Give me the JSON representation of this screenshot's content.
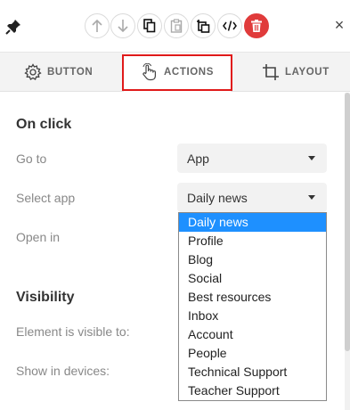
{
  "toolbar": {
    "buttons": [
      {
        "name": "move-up",
        "icon": "arrow-up-icon"
      },
      {
        "name": "move-down",
        "icon": "arrow-down-icon"
      },
      {
        "name": "copy",
        "icon": "copy-icon"
      },
      {
        "name": "paste",
        "icon": "clipboard-icon"
      },
      {
        "name": "duplicate",
        "icon": "duplicate-icon"
      },
      {
        "name": "code",
        "icon": "code-icon"
      },
      {
        "name": "delete",
        "icon": "trash-icon"
      }
    ],
    "pin_icon": "pin-icon",
    "close_label": "×",
    "delete_color": "#e03b3b"
  },
  "tabs": [
    {
      "label": "BUTTON",
      "icon": "gear-icon",
      "active": false
    },
    {
      "label": "ACTIONS",
      "icon": "hand-pointer-icon",
      "active": true
    },
    {
      "label": "LAYOUT",
      "icon": "crop-icon",
      "active": false
    }
  ],
  "on_click": {
    "title": "On click",
    "go_to_label": "Go to",
    "go_to_value": "App",
    "select_app_label": "Select app",
    "select_app_value": "Daily news",
    "open_in_label": "Open in"
  },
  "visibility": {
    "title": "Visibility",
    "visible_to_label": "Element is visible to:",
    "devices_label": "Show in devices:"
  },
  "dropdown": {
    "selected": "Daily news",
    "options": [
      "Daily news",
      "Profile",
      "Blog",
      "Social",
      "Best resources",
      "Inbox",
      "Account",
      "People",
      "Technical Support",
      "Teacher Support"
    ]
  },
  "colors": {
    "highlight": "#e01a1a",
    "selected_option": "#1e90ff"
  }
}
